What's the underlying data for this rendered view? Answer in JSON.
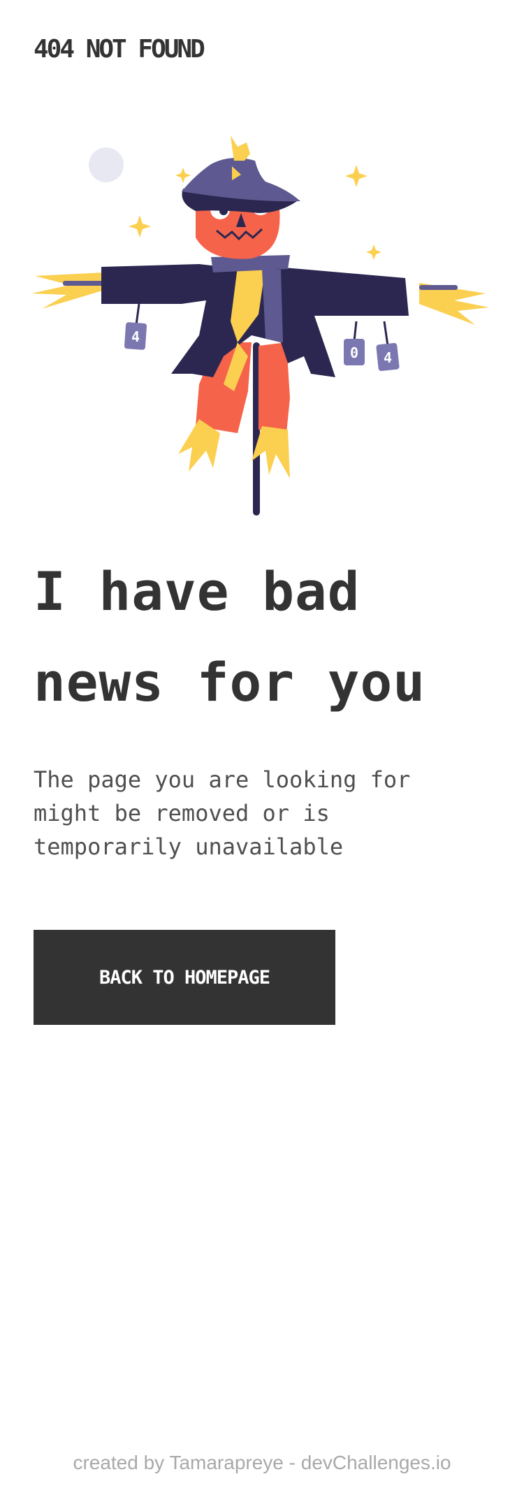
{
  "header": {
    "logo_text": "404 NOT FOUND"
  },
  "illustration": {
    "subject": "scarecrow",
    "can_labels": [
      "4",
      "0",
      "4"
    ],
    "colors": {
      "hat": "#5e5a91",
      "coat": "#2b2750",
      "pumpkin": "#f5634a",
      "straw": "#fbcf4f",
      "scarf": "#5e5a91",
      "can": "#7b77b1",
      "moon": "#e8e8f3"
    }
  },
  "main": {
    "headline": "I have bad news for you",
    "description": "The page you are looking for might be removed or is temporarily unavailable",
    "cta_label": "BACK TO HOMEPAGE"
  },
  "footer": {
    "credit": "created by Tamarapreye - devChallenges.io"
  },
  "theme": {
    "text": "#333333",
    "button_bg": "#333333",
    "button_text": "#ffffff",
    "footer_text": "#a9a9a9"
  }
}
